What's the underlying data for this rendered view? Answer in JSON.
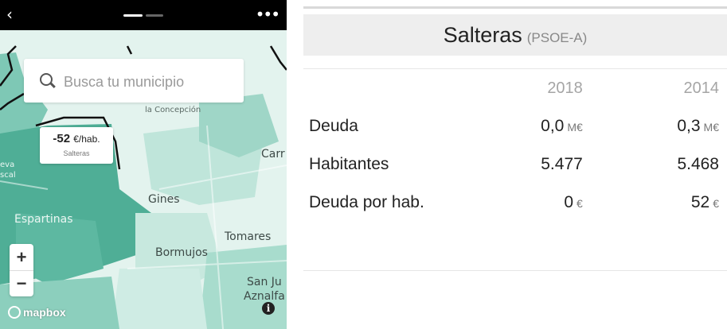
{
  "topbar": {
    "back_icon": "chevron-left-icon",
    "more_icon": "more-dots-icon"
  },
  "map": {
    "search": {
      "placeholder": "Busca tu municipio",
      "icon": "search-icon"
    },
    "tooltip": {
      "value": "-52",
      "unit": "€/hab.",
      "name": "Salteras"
    },
    "labels": {
      "concepcion": "la Concepción",
      "carr": "Carr",
      "gines": "Gines",
      "espartinas": "Espartinas",
      "tomares": "Tomares",
      "bormujos": "Bormujos",
      "sanju": "San Ju",
      "aznalfa": "Aznalfa",
      "eva": "eva",
      "scal": "scal"
    },
    "zoom": {
      "in": "+",
      "out": "−"
    },
    "attribution": "mapbox",
    "info": "i",
    "colors": {
      "dark": "#4fae96",
      "mid": "#7ec8b5",
      "light": "#b6e0d4",
      "pale": "#d6efe8",
      "border": "#111111"
    }
  },
  "detail": {
    "municipality": "Salteras",
    "party": "(PSOE-A)",
    "years": [
      "2018",
      "2014"
    ],
    "rows": [
      {
        "label": "Deuda",
        "values": [
          "0,0",
          "0,3"
        ],
        "unit": "M€"
      },
      {
        "label": "Habitantes",
        "values": [
          "5.477",
          "5.468"
        ],
        "unit": ""
      },
      {
        "label": "Deuda por hab.",
        "values": [
          "0",
          "52"
        ],
        "unit": "€"
      }
    ]
  }
}
